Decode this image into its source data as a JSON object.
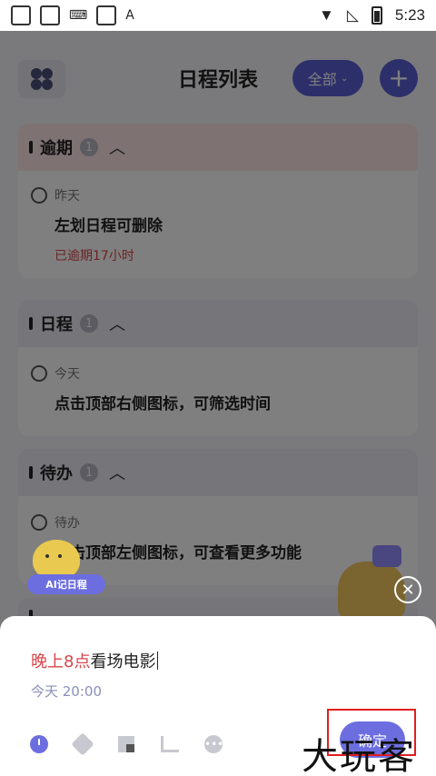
{
  "status_bar": {
    "time": "5:23"
  },
  "header": {
    "title": "日程列表",
    "filter_label": "全部",
    "add_symbol": "+"
  },
  "sections": [
    {
      "title": "逾期",
      "count": "1",
      "item": {
        "day": "昨天",
        "title": "左划日程可删除",
        "note": "已逾期17小时"
      }
    },
    {
      "title": "日程",
      "count": "1",
      "item": {
        "day": "今天",
        "title": "点击顶部右侧图标，可筛选时间"
      }
    },
    {
      "title": "待办",
      "count": "1",
      "item": {
        "day": "待办",
        "title": "点击顶部左侧图标，可查看更多功能"
      }
    }
  ],
  "ai_mascot": {
    "label": "AI记日程"
  },
  "sheet": {
    "input_time": "晚上8点",
    "input_text": "看场电影",
    "date_hint": "今天 20:00",
    "confirm_label": "确定"
  },
  "watermark": "大玩客",
  "colors": {
    "accent": "#5a5fd6",
    "overdue": "#d8454a",
    "highlight_box": "#e01f1f"
  }
}
